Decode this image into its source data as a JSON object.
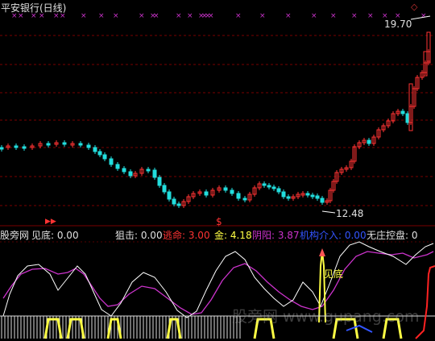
{
  "title": "平安银行(日线)",
  "price_high": "19.70",
  "price_low": "12.48",
  "dollar_marker": "$",
  "arrow_marker": "▶▶",
  "annotation_jiandi": "见底",
  "watermark": "股旁网 www.gupang.com",
  "indicator": {
    "source": "股旁网",
    "jiandi": "见底: 0.00",
    "juji": "狙击: 0.00",
    "taoming": "逃命: 3.00",
    "jin": "金: 4.18",
    "yinyang": "阴阳: 3.87",
    "jigou": "机构介入: 0.00",
    "wuzhuang": "无庄控盘: 0"
  },
  "colors": {
    "up": "#ff3333",
    "down": "#22dddd",
    "grid": "#7a0000",
    "cross": "#cc33cc",
    "white": "#ffffff",
    "yellow": "#ffff44",
    "magenta": "#cc33cc",
    "red": "#ff2222",
    "blue": "#3355ff"
  }
}
